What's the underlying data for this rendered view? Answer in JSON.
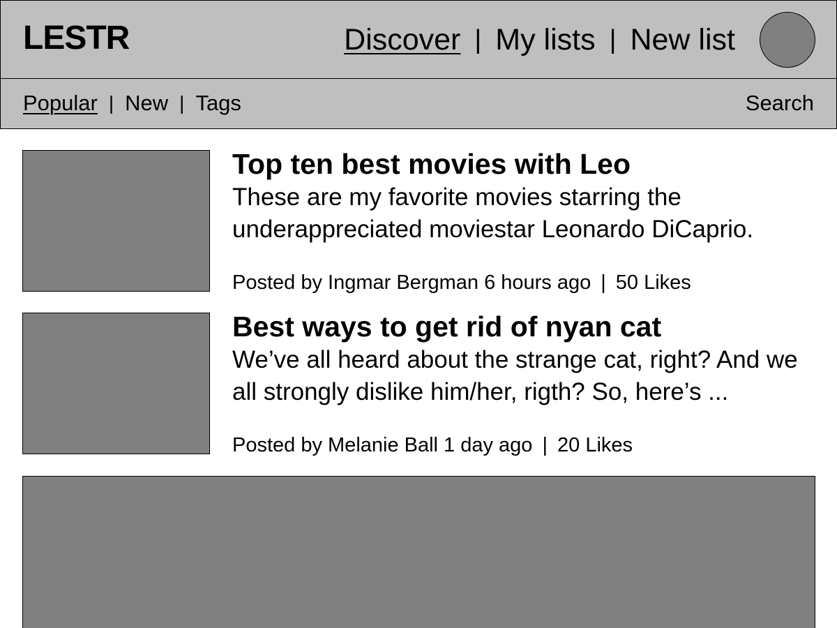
{
  "app": {
    "logo": "LESTR"
  },
  "main_nav": {
    "items": [
      {
        "label": "Discover",
        "active": true
      },
      {
        "label": "My lists",
        "active": false
      },
      {
        "label": "New list",
        "active": false
      }
    ],
    "separator": "|"
  },
  "sub_nav": {
    "items": [
      {
        "label": "Popular",
        "active": true
      },
      {
        "label": "New",
        "active": false
      },
      {
        "label": "Tags",
        "active": false
      }
    ],
    "separator": "|",
    "search_label": "Search"
  },
  "feed": [
    {
      "title": "Top ten best movies with Leo",
      "description": "These are my favorite movies starring the underappreciated moviestar Leonardo DiCaprio.",
      "meta": "Posted by Ingmar Bergman 6 hours ago",
      "likes": "50 Likes"
    },
    {
      "title": "Best ways to get rid of nyan cat",
      "description": "We’ve all heard about the strange cat, right? And we all strongly dislike him/her, rigth? So, here’s ...",
      "meta": "Posted by Melanie Ball 1 day ago",
      "likes": "20 Likes"
    }
  ],
  "colors": {
    "header_bg": "#bfbfbf",
    "placeholder": "#808080",
    "border": "#000000",
    "page_bg": "#ffffff"
  }
}
